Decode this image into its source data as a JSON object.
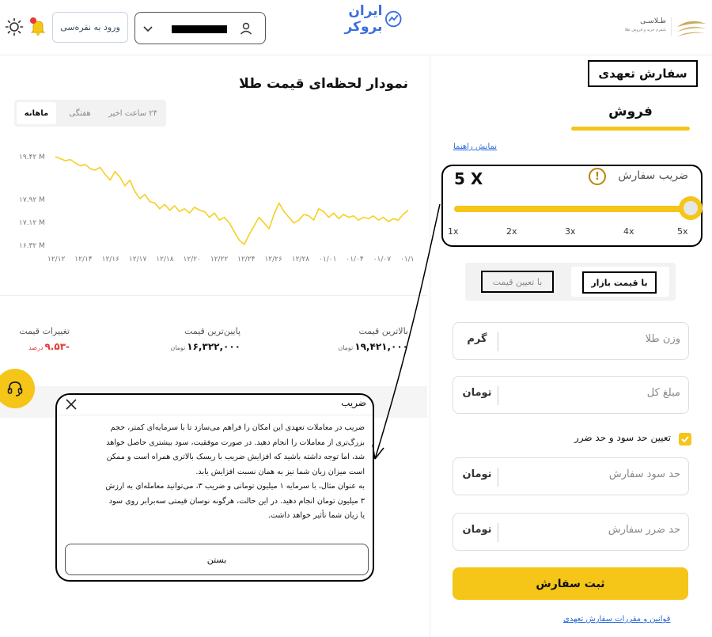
{
  "header": {
    "login_label": "ورود به نقره‌سی",
    "brand_name": "ایران بروکر",
    "talasi_name": "طـلاسـی",
    "talasi_tagline": "پلتفرم خرید و فروش طلا",
    "icons": [
      "sun-icon",
      "bell-icon",
      "chevron-down-icon",
      "user-icon"
    ]
  },
  "chart": {
    "title": "نمودار لحظه‌ای قیمت طلا",
    "tabs": [
      {
        "label": "۲۴ ساعت اخیر",
        "active": false
      },
      {
        "label": "هفتگی",
        "active": false
      },
      {
        "label": "ماهانه",
        "active": true
      }
    ],
    "line_color": "#f5d020"
  },
  "chart_data": {
    "type": "line",
    "title": "نمودار لحظه‌ای قیمت طلا",
    "x_ticks": [
      "۱۲/۱۲",
      "۱۲/۱۴",
      "۱۲/۱۶",
      "۱۲/۱۷",
      "۱۲/۱۸",
      "۱۲/۲۰",
      "۱۲/۲۲",
      "۱۲/۲۴",
      "۱۲/۲۶",
      "۱۲/۲۸",
      "۰۱/۰۱",
      "۰۱/۰۴",
      "۰۱/۰۷",
      "۰۱/۱"
    ],
    "y_ticks": [
      {
        "label": "۱۹.۴۲ M",
        "value": 19.42
      },
      {
        "label": "۱۷.۹۲ M",
        "value": 17.92
      },
      {
        "label": "۱۷.۱۲ M",
        "value": 17.12
      },
      {
        "label": "۱۶.۳۲ M",
        "value": 16.32
      }
    ],
    "ylim": [
      16.32,
      19.42
    ],
    "series": [
      {
        "values": [
          19.42,
          19.35,
          19.28,
          19.32,
          19.2,
          19.1,
          19.15,
          19.0,
          18.95,
          19.05,
          18.8,
          18.6,
          18.9,
          18.7,
          18.4,
          18.6,
          18.2,
          17.95,
          18.1,
          17.85,
          17.8,
          17.6,
          17.75,
          17.55,
          17.7,
          17.5,
          17.6,
          17.45,
          17.65,
          17.55,
          17.5,
          17.3,
          17.45,
          17.2,
          17.3,
          17.1,
          16.8,
          16.5,
          16.35,
          16.7,
          17.0,
          17.3,
          17.1,
          16.9,
          17.4,
          17.8,
          17.5,
          17.3,
          17.1,
          17.2,
          17.4,
          17.35,
          17.2,
          17.6,
          17.5,
          17.3,
          17.45,
          17.25,
          17.4,
          17.3,
          17.35,
          17.2,
          17.3,
          17.25,
          17.35,
          17.2,
          17.3,
          17.15,
          17.25,
          17.2,
          17.4,
          17.55
        ]
      }
    ]
  },
  "stats": {
    "high": {
      "label": "بالاترین قیمت",
      "value": "۱۹,۴۲۱,۰۰۰",
      "unit": "تومان"
    },
    "low": {
      "label": "پایین‌ترین قیمت",
      "value": "۱۶,۳۲۲,۰۰۰",
      "unit": "تومان"
    },
    "change": {
      "label": "تغییرات قیمت",
      "value": "-۹.۵۳",
      "unit": "درصد"
    }
  },
  "modal": {
    "title": "ضریب",
    "body": [
      "ضریب در معاملات تعهدی این امکان را فراهم می‌سازد تا با سرمایه‌ای کمتر، حجم",
      "بزرگ‌تری از معاملات را انجام دهید. در صورت موفقیت، سود بیشتری حاصل خواهد",
      "شد، اما توجه داشته باشید که افزایش ضریب با ریسک بالاتری همراه است و ممکن",
      "است میزان زیان شما نیز به همان نسبت افزایش یابد.",
      "به عنوان مثال، با سرمایه ۱ میلیون تومانی و ضریب ۳، می‌توانید معامله‌ای به ارزش",
      "۳ میلیون تومان انجام دهید. در این حالت، هرگونه نوسان قیمتی سه‌برابر روی سود",
      "یا زیان شما تأثیر خواهد داشت."
    ],
    "close_label": "بستن"
  },
  "order": {
    "order_type": "سفارش تعهدی",
    "side_tab": "فروش",
    "guide_link": "نمایش راهنما",
    "leverage": {
      "label": "ضریب سفارش",
      "value": "5 X",
      "ticks": [
        "1x",
        "2x",
        "3x",
        "4x",
        "5x"
      ],
      "level": 5,
      "max": 5
    },
    "price_type": {
      "market": "با قیمت بازار",
      "limit": "با تعیین قیمت"
    },
    "weight": {
      "placeholder": "وزن طلا",
      "unit": "گرم"
    },
    "total": {
      "placeholder": "مبلغ کل",
      "unit": "تومان"
    },
    "tp_sl_label": "تعیین حد سود و حد ضرر",
    "take_profit": {
      "placeholder": "حد سود سفارش",
      "unit": "تومان"
    },
    "stop_loss": {
      "placeholder": "حد ضرر سفارش",
      "unit": "تومان"
    },
    "submit_label": "ثبت سفارش",
    "rules_link": "قوانین و مقررات سفارش تعهدی"
  },
  "colors": {
    "accent": "#f5c518",
    "link": "#2a6ad8",
    "negative": "#e53935"
  }
}
